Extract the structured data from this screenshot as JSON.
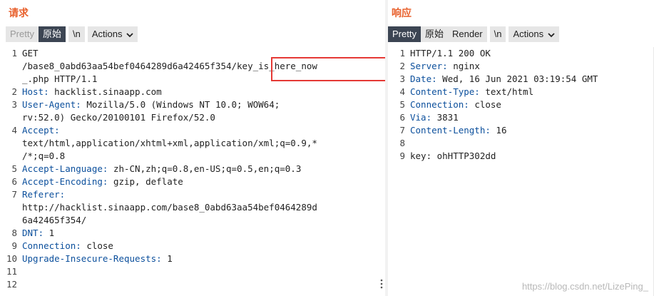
{
  "request": {
    "title": "请求",
    "tabs": [
      "Pretty",
      "原始",
      "\\n"
    ],
    "actions_label": "Actions",
    "lines": [
      {
        "n": "1",
        "key": "",
        "text": "GET"
      },
      {
        "n": "",
        "key": "",
        "text": "/base8_0abd63aa54bef0464289d6a42465f354/key_is_here_now"
      },
      {
        "n": "",
        "key": "",
        "text": "_.php HTTP/1.1"
      },
      {
        "n": "2",
        "key": "Host:",
        "text": " hacklist.sinaapp.com"
      },
      {
        "n": "3",
        "key": "User-Agent:",
        "text": " Mozilla/5.0 (Windows NT 10.0; WOW64;"
      },
      {
        "n": "",
        "key": "",
        "text": "rv:52.0) Gecko/20100101 Firefox/52.0"
      },
      {
        "n": "4",
        "key": "Accept:",
        "text": ""
      },
      {
        "n": "",
        "key": "",
        "text": "text/html,application/xhtml+xml,application/xml;q=0.9,*"
      },
      {
        "n": "",
        "key": "",
        "text": "/*;q=0.8"
      },
      {
        "n": "5",
        "key": "Accept-Language:",
        "text": " zh-CN,zh;q=0.8,en-US;q=0.5,en;q=0.3"
      },
      {
        "n": "6",
        "key": "Accept-Encoding:",
        "text": " gzip, deflate"
      },
      {
        "n": "7",
        "key": "Referer:",
        "text": ""
      },
      {
        "n": "",
        "key": "",
        "text": "http://hacklist.sinaapp.com/base8_0abd63aa54bef0464289d"
      },
      {
        "n": "",
        "key": "",
        "text": "6a42465f354/"
      },
      {
        "n": "8",
        "key": "DNT:",
        "text": " 1"
      },
      {
        "n": "9",
        "key": "Connection:",
        "text": " close"
      },
      {
        "n": "10",
        "key": "Upgrade-Insecure-Requests:",
        "text": " 1"
      },
      {
        "n": "11",
        "key": "",
        "text": ""
      },
      {
        "n": "12",
        "key": "",
        "text": ""
      }
    ]
  },
  "response": {
    "title": "响应",
    "tabs": [
      "Pretty",
      "原始",
      "Render",
      "\\n"
    ],
    "actions_label": "Actions",
    "lines": [
      {
        "n": "1",
        "key": "",
        "text": "HTTP/1.1 200 OK"
      },
      {
        "n": "2",
        "key": "Server:",
        "text": " nginx"
      },
      {
        "n": "3",
        "key": "Date:",
        "text": " Wed, 16 Jun 2021 03:19:54 GMT"
      },
      {
        "n": "4",
        "key": "Content-Type:",
        "text": " text/html"
      },
      {
        "n": "5",
        "key": "Connection:",
        "text": " close"
      },
      {
        "n": "6",
        "key": "Via:",
        "text": " 3831"
      },
      {
        "n": "7",
        "key": "Content-Length:",
        "text": " 16"
      },
      {
        "n": "8",
        "key": "",
        "text": ""
      },
      {
        "n": "9",
        "key": "",
        "text": "key: ohHTTP302dd"
      }
    ]
  },
  "watermark": "https://blog.csdn.net/LizePing_",
  "colors": {
    "accent": "#e8602c",
    "active_tab": "#3c4553",
    "header_key": "#0b4f9c",
    "highlight": "#e53935"
  }
}
